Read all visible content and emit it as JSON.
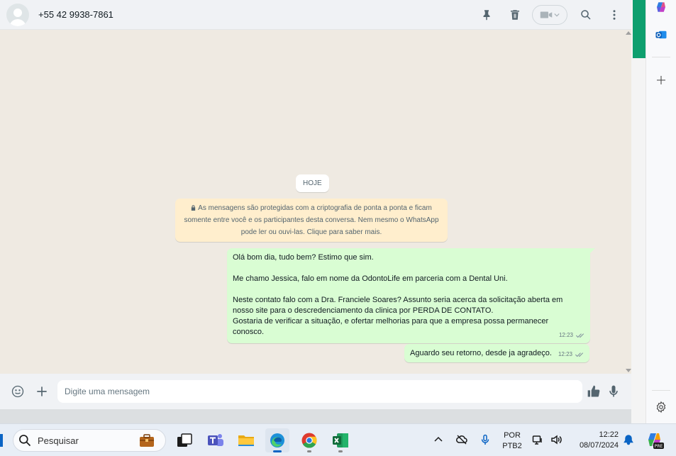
{
  "header": {
    "contact_name": "+55 42 9938-7861",
    "icons": [
      "pin-icon",
      "trash-icon",
      "video-camera-icon",
      "search-icon",
      "more-vertical-icon"
    ]
  },
  "chat": {
    "date_chip": "HOJE",
    "encryption_notice": {
      "line1": "As mensagens são protegidas com a criptografia de ponta a ponta e ficam",
      "line2": "somente entre você e os participantes desta conversa. Nem mesmo o WhatsApp",
      "line3": "pode ler ou ouvi-las. Clique para saber mais."
    },
    "messages": [
      {
        "lines": [
          "Olá bom dia, tudo bem? Estimo que sim.",
          "",
          "Me chamo Jessica, falo em nome da OdontoLife em parceria com a Dental Uni.",
          "",
          "Neste contato falo com a Dra. Franciele Soares? Assunto seria acerca da solicitação aberta em",
          "nosso site para o descredenciamento da clinica por PERDA DE CONTATO.",
          "Gostaria de verificar a situação, e ofertar melhorias para que a empresa possa permanecer",
          "conosco."
        ],
        "time": "12:23"
      },
      {
        "lines": [
          "Aguardo seu retorno, desde ja agradeço."
        ],
        "time": "12:23"
      }
    ]
  },
  "composer": {
    "placeholder": "Digite uma mensagem"
  },
  "taskbar": {
    "search_label": "Pesquisar",
    "language": "POR",
    "keyboard": "PTB2",
    "time": "12:22",
    "date": "08/07/2024"
  },
  "colors": {
    "outgoing_bubble": "#d9fdd3",
    "notice_bubble": "#ffeecd",
    "chat_background": "#efeae2",
    "accent_green": "#0e9f6e"
  }
}
